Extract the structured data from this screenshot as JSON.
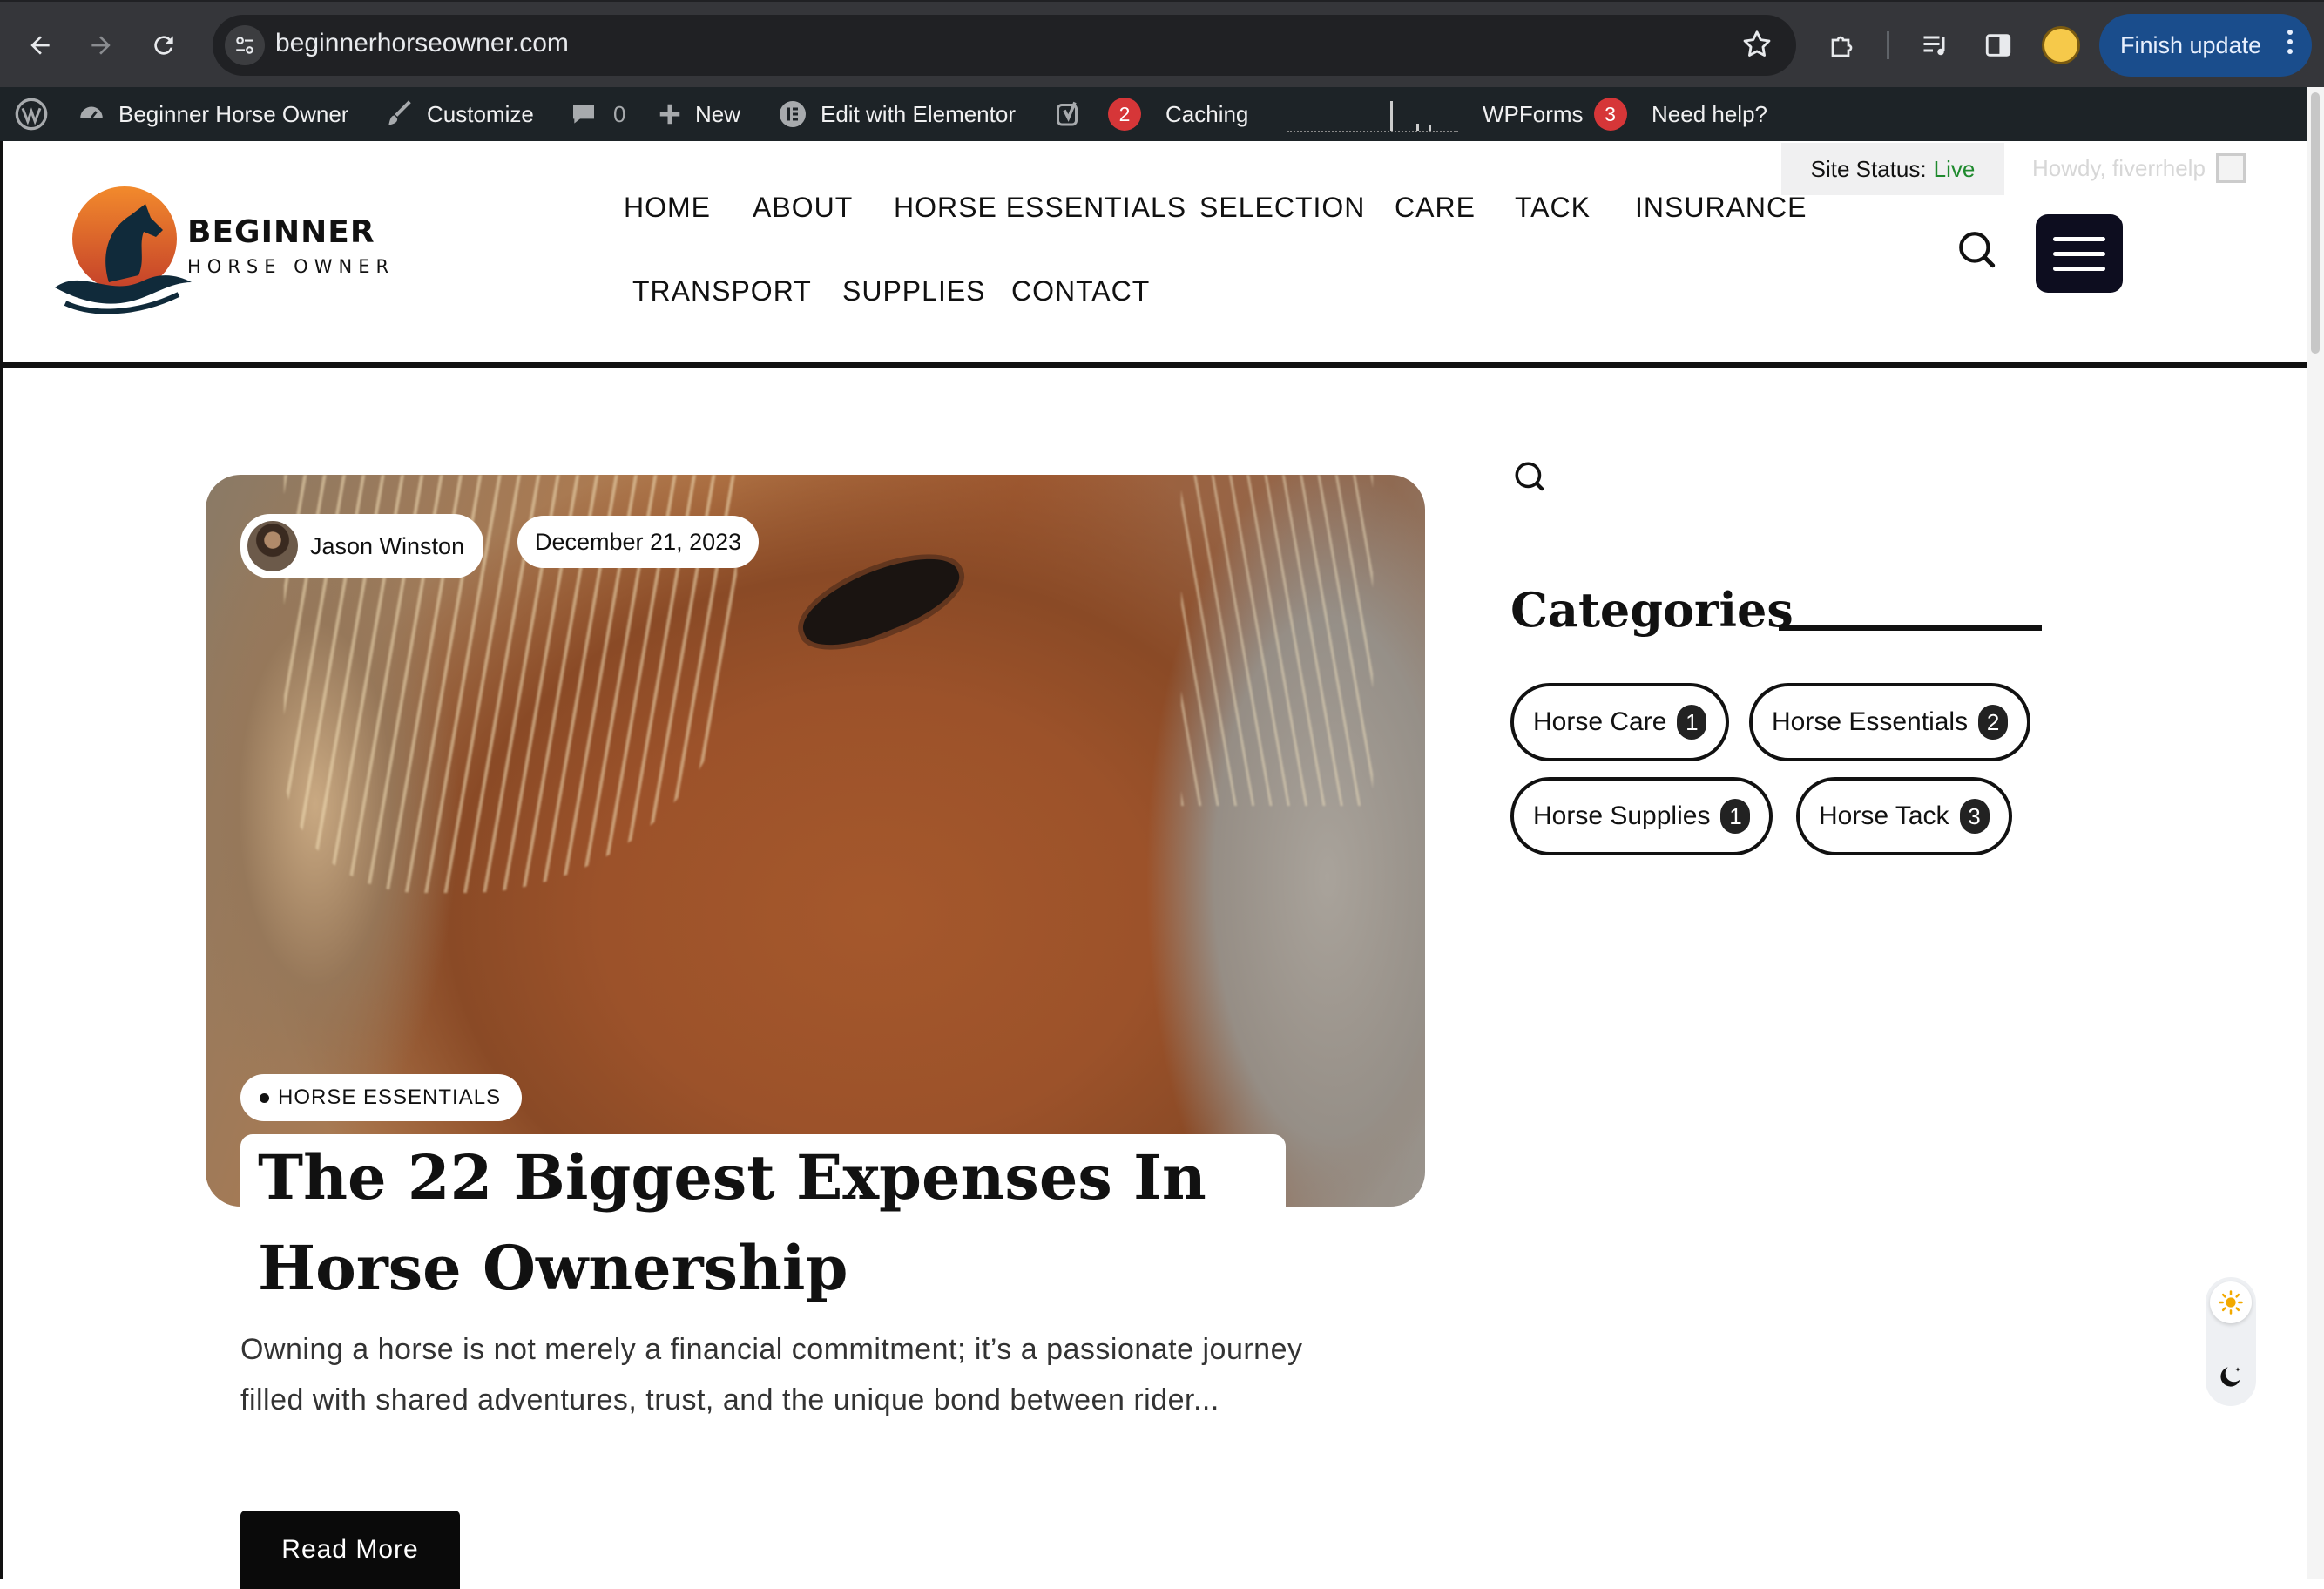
{
  "browser": {
    "url": "beginnerhorseowner.com",
    "finish_update_label": "Finish update"
  },
  "admin_bar": {
    "site_name": "Beginner Horse Owner",
    "customize": "Customize",
    "comments_count": "0",
    "new": "New",
    "edit_elementor": "Edit with Elementor",
    "yoast_badge": "2",
    "caching": "Caching",
    "wpforms": "WPForms",
    "wpforms_badge": "3",
    "need_help": "Need help?"
  },
  "header": {
    "site_status_label": "Site Status:",
    "site_status_value": "Live",
    "howdy": "Howdy, fiverrhelp",
    "brand_line1": "BEGINNER",
    "brand_line2": "HORSE OWNER",
    "nav": [
      "HOME",
      "ABOUT",
      "HORSE ESSENTIALS",
      "SELECTION",
      "CARE",
      "TACK",
      "INSURANCE",
      "TRANSPORT",
      "SUPPLIES",
      "CONTACT"
    ]
  },
  "post": {
    "author": "Jason Winston",
    "date": "December 21, 2023",
    "category": "HORSE ESSENTIALS",
    "title": "The 22 Biggest Expenses In Horse Ownership",
    "excerpt": "Owning a horse is not merely a financial commitment; it’s a passionate journey filled with shared adventures, trust, and the unique bond between rider...",
    "read_more": "Read More"
  },
  "sidebar": {
    "categories_heading": "Categories",
    "categories": [
      {
        "name": "Horse Care",
        "count": "1"
      },
      {
        "name": "Horse Essentials",
        "count": "2"
      },
      {
        "name": "Horse Supplies",
        "count": "1"
      },
      {
        "name": "Horse Tack",
        "count": "3"
      }
    ]
  },
  "colors": {
    "accent_button": "#1a4d8c",
    "admin_bar": "#1d2327",
    "badge": "#d63638",
    "live": "#1f8a2e",
    "hamburger": "#0d0d1f"
  },
  "icons": {
    "back": "arrow-left-icon",
    "forward": "arrow-right-icon",
    "reload": "reload-icon",
    "bookmark": "star-icon",
    "search": "search-icon",
    "menu": "hamburger-icon",
    "theme_light": "sun-icon",
    "theme_dark": "moon-icon"
  }
}
